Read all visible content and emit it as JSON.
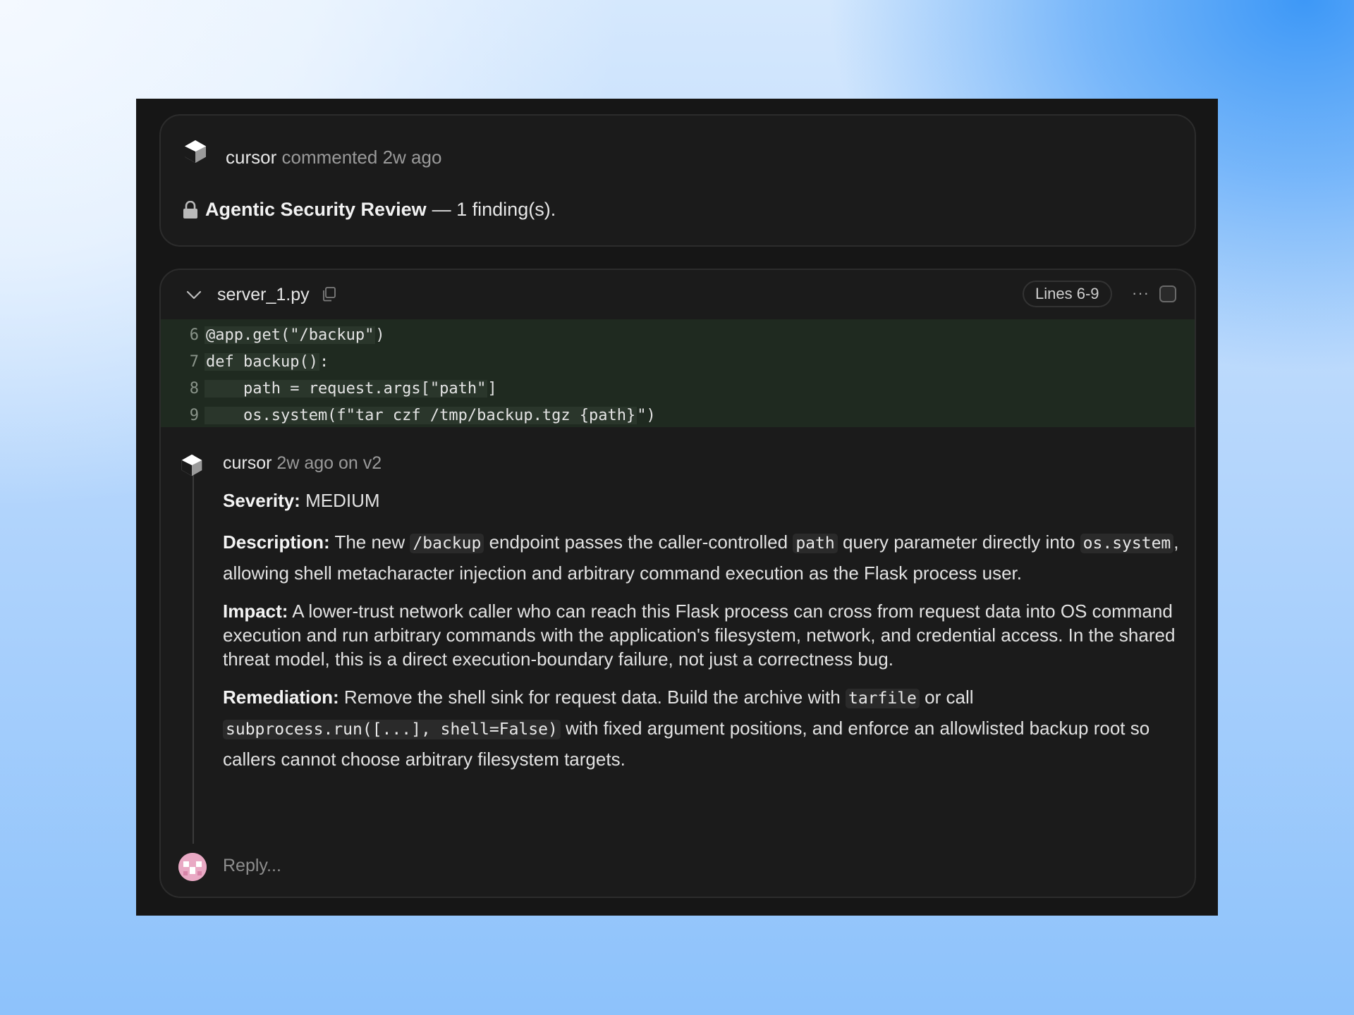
{
  "comment": {
    "author": "cursor",
    "action": "commented",
    "time": "2w ago",
    "title_bold": "Agentic Security Review",
    "title_rest": "— 1 finding(s)."
  },
  "file": {
    "name": "server_1.py",
    "lines_badge": "Lines 6-9",
    "more": "···",
    "code": [
      {
        "num": "6",
        "text": "@app.get(\"/backup\"",
        "tail": ")"
      },
      {
        "num": "7",
        "text": "def backup()",
        "tail": ":"
      },
      {
        "num": "8",
        "text": "    path = request.args[\"path\"",
        "tail": "]"
      },
      {
        "num": "9",
        "text": "    os.system(f\"tar czf /tmp/backup.tgz {path}",
        "tail": "\")"
      }
    ]
  },
  "reply": {
    "author": "cursor",
    "meta": "2w ago on v2",
    "severity_label": "Severity:",
    "severity_value": "MEDIUM",
    "description_label": "Description:",
    "desc_1": "The new",
    "desc_code_1": "/backup",
    "desc_2": "endpoint passes the caller-controlled",
    "desc_code_2": "path",
    "desc_3": "query parameter directly into",
    "desc_code_3": "os.system",
    "desc_4": ", allowing shell metacharacter injection and arbitrary command execution as the Flask process user.",
    "impact_label": "Impact:",
    "impact_text": "A lower-trust network caller who can reach this Flask process can cross from request data into OS command execution and run arbitrary commands with the application's filesystem, network, and credential access. In the shared threat model, this is a direct execution-boundary failure, not just a correctness bug.",
    "remediation_label": "Remediation:",
    "rem_1": "Remove the shell sink for request data. Build the archive with",
    "rem_code_1": "tarfile",
    "rem_2": "or call",
    "rem_code_2": "subprocess.run([...], shell=False)",
    "rem_3": "with fixed argument positions, and enforce an allowlisted backup root so callers cannot choose arbitrary filesystem targets."
  },
  "reply_box": {
    "placeholder": "Reply..."
  },
  "colors": {
    "window_bg": "#161616",
    "card_bg": "#1b1b1b",
    "code_bg": "#1f2a20",
    "avatar": "#e9a9c4"
  }
}
